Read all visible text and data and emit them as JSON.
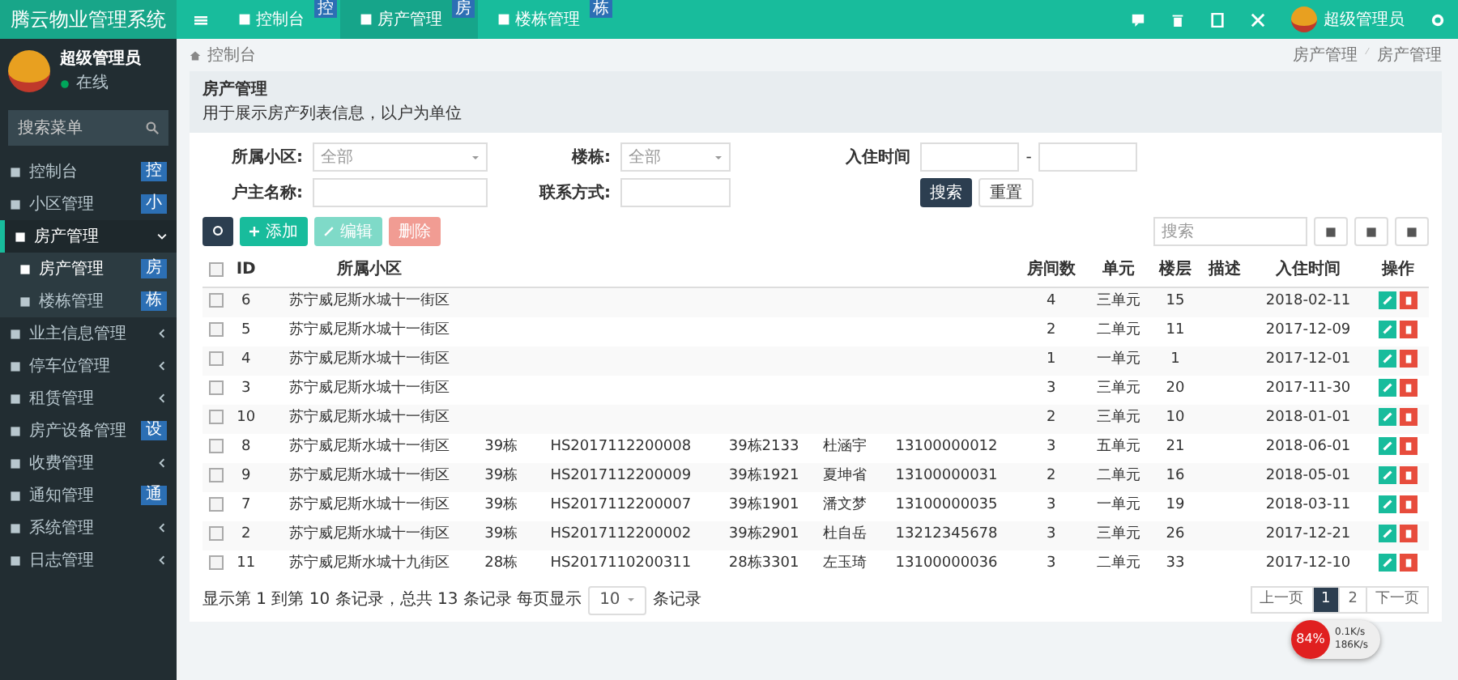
{
  "brand": "腾云物业管理系统",
  "top_tabs": [
    {
      "label": "控制台",
      "badge": "控",
      "selected": false
    },
    {
      "label": "房产管理",
      "badge": "房",
      "selected": true
    },
    {
      "label": "楼栋管理",
      "badge": "栋",
      "selected": false
    }
  ],
  "top_user": "超级管理员",
  "sidebar": {
    "user": {
      "name": "超级管理员",
      "status": "在线"
    },
    "search": {
      "placeholder": "搜索菜单"
    },
    "items": [
      {
        "label": "控制台",
        "badge": "控",
        "selected": false
      },
      {
        "label": "小区管理",
        "badge": "小",
        "selected": false
      },
      {
        "label": "房产管理",
        "expanded": true,
        "selected": true,
        "children": [
          {
            "label": "房产管理",
            "badge": "房",
            "selected": true
          },
          {
            "label": "楼栋管理",
            "badge": "栋",
            "selected": false
          }
        ]
      },
      {
        "label": "业主信息管理",
        "expanded": false,
        "selected": false
      },
      {
        "label": "停车位管理",
        "expanded": false,
        "selected": false
      },
      {
        "label": "租赁管理",
        "expanded": false,
        "selected": false
      },
      {
        "label": "房产设备管理",
        "badge": "设",
        "selected": false
      },
      {
        "label": "收费管理",
        "expanded": false,
        "selected": false
      },
      {
        "label": "通知管理",
        "badge": "通",
        "selected": false
      },
      {
        "label": "系统管理",
        "expanded": false,
        "selected": false
      },
      {
        "label": "日志管理",
        "expanded": false,
        "selected": false
      }
    ]
  },
  "breadcrumb": {
    "home": "控制台",
    "trail": [
      "房产管理",
      "房产管理"
    ]
  },
  "panel": {
    "title": "房产管理",
    "subtitle": "用于展示房产列表信息，以户为单位"
  },
  "filters": {
    "community": {
      "label": "所属小区:",
      "value": "全部"
    },
    "building": {
      "label": "楼栋:",
      "value": "全部"
    },
    "checkin": {
      "label": "入住时间",
      "separator": "-"
    },
    "owner": {
      "label": "户主名称:"
    },
    "phone": {
      "label": "联系方式:"
    },
    "buttons": [
      "搜索",
      "重置"
    ]
  },
  "toolbar": {
    "add": "添加",
    "edit": "编辑",
    "delete": "删除",
    "edit_disabled": true,
    "delete_disabled": true,
    "search_placeholder": "搜索"
  },
  "table": {
    "header_checked": false,
    "columns": [
      "ID",
      "所属小区",
      null,
      null,
      null,
      null,
      null,
      "房间数",
      "单元",
      "楼层",
      "描述",
      "入住时间",
      "操作"
    ],
    "rows": [
      {
        "checked": false,
        "cells": [
          "6",
          "苏宁威尼斯水城十一街区",
          null,
          null,
          null,
          null,
          null,
          "4",
          "三单元",
          "15",
          null,
          "2018-02-11"
        ]
      },
      {
        "checked": false,
        "cells": [
          "5",
          "苏宁威尼斯水城十一街区",
          null,
          null,
          null,
          null,
          null,
          "2",
          "二单元",
          "11",
          null,
          "2017-12-09"
        ]
      },
      {
        "checked": false,
        "cells": [
          "4",
          "苏宁威尼斯水城十一街区",
          null,
          null,
          null,
          null,
          null,
          "1",
          "一单元",
          "1",
          null,
          "2017-12-01"
        ]
      },
      {
        "checked": false,
        "cells": [
          "3",
          "苏宁威尼斯水城十一街区",
          null,
          null,
          null,
          null,
          null,
          "3",
          "三单元",
          "20",
          null,
          "2017-11-30"
        ]
      },
      {
        "checked": false,
        "cells": [
          "10",
          "苏宁威尼斯水城十一街区",
          null,
          null,
          null,
          null,
          null,
          "2",
          "三单元",
          "10",
          null,
          "2018-01-01"
        ]
      },
      {
        "checked": false,
        "cells": [
          "8",
          "苏宁威尼斯水城十一街区",
          "39栋",
          "HS2017112200008",
          "39栋2133",
          "杜涵宇",
          "13100000012",
          "3",
          "五单元",
          "21",
          null,
          "2018-06-01"
        ]
      },
      {
        "checked": false,
        "cells": [
          "9",
          "苏宁威尼斯水城十一街区",
          "39栋",
          "HS2017112200009",
          "39栋1921",
          "夏坤省",
          "13100000031",
          "2",
          "二单元",
          "16",
          null,
          "2018-05-01"
        ]
      },
      {
        "checked": false,
        "cells": [
          "7",
          "苏宁威尼斯水城十一街区",
          "39栋",
          "HS2017112200007",
          "39栋1901",
          "潘文梦",
          "13100000035",
          "3",
          "一单元",
          "19",
          null,
          "2018-03-11"
        ]
      },
      {
        "checked": false,
        "cells": [
          "2",
          "苏宁威尼斯水城十一街区",
          "39栋",
          "HS2017112200002",
          "39栋2901",
          "杜自岳",
          "13212345678",
          "3",
          "三单元",
          "26",
          null,
          "2017-12-21"
        ]
      },
      {
        "checked": false,
        "cells": [
          "11",
          "苏宁威尼斯水城十九街区",
          "28栋",
          "HS2017110200311",
          "28栋3301",
          "左玉琦",
          "13100000036",
          "3",
          "二单元",
          "33",
          null,
          "2017-12-10"
        ]
      }
    ]
  },
  "footer": {
    "summary": "显示第 1 到第 10 条记录，总共 13 条记录 每页显示",
    "page_size": "10",
    "suffix": "条记录"
  },
  "pagination": [
    {
      "label": "上一页",
      "selected": false
    },
    {
      "label": "1",
      "selected": true
    },
    {
      "label": "2",
      "selected": false
    },
    {
      "label": "下一页",
      "selected": false
    }
  ],
  "speed_widget": {
    "percent": "84%",
    "up": "0.1K/s",
    "down": "186K/s"
  }
}
